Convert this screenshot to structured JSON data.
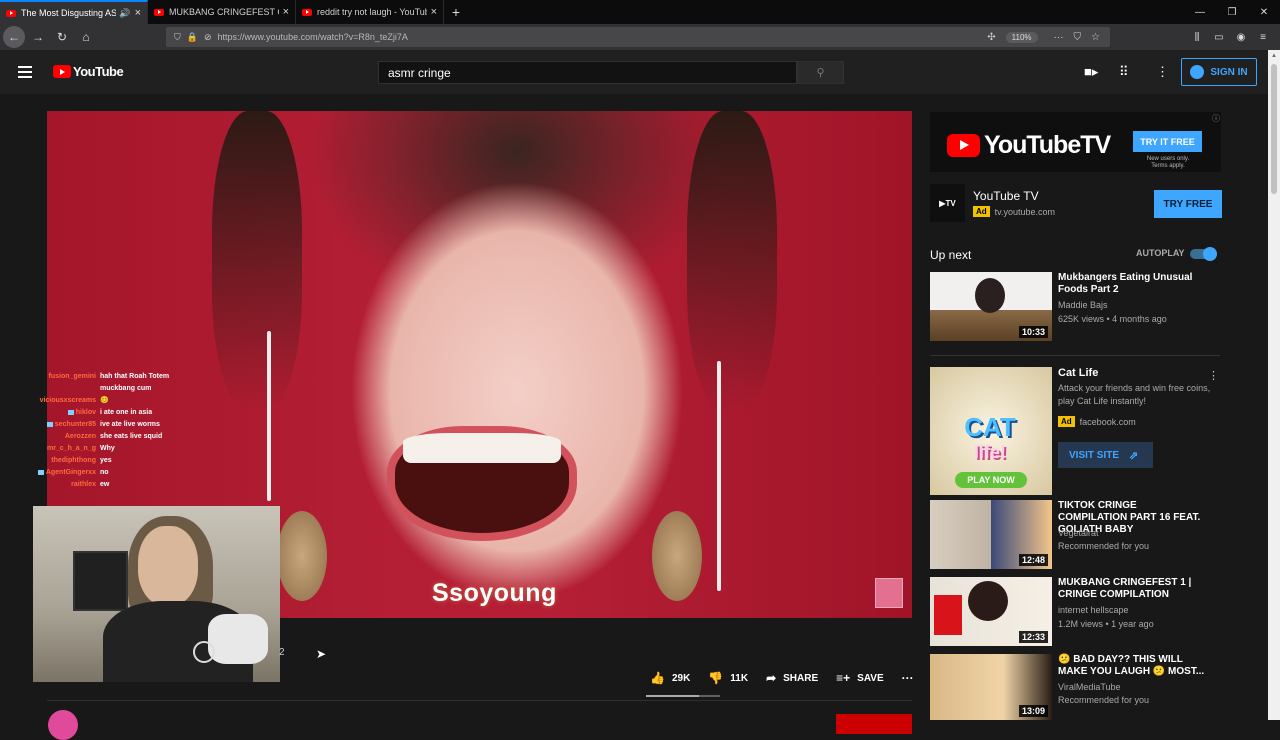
{
  "browser": {
    "tabs": [
      {
        "title": "The Most Disgusting ASMR",
        "active": true,
        "audio": true
      },
      {
        "title": "MUKBANG CRINGEFEST CRING",
        "active": false
      },
      {
        "title": "reddit try not laugh - YouTube",
        "active": false
      }
    ],
    "url": "https://www.youtube.com/watch?v=R8n_teZji7A",
    "zoom": "110%"
  },
  "header": {
    "logo_text": "YouTube",
    "search_value": "asmr cringe",
    "signin_label": "SIGN IN"
  },
  "video": {
    "subtitle": "Ssoyoung",
    "stray_char": "2"
  },
  "chat": [
    {
      "user": "fusion_gemini",
      "color": "#ff6a3d",
      "msg": "hah that Roah Totem"
    },
    {
      "user": "",
      "color": "#c02020",
      "msg": "muckbang cum"
    },
    {
      "user": "viciousxscreams",
      "color": "#ff6a3d",
      "msg": "😊"
    },
    {
      "user": "hiklov",
      "color": "#ff6a3d",
      "msg": "i ate one in asia",
      "badge": true
    },
    {
      "user": "sechunter85",
      "color": "#ff6a3d",
      "msg": "ive ate live worms",
      "badge": true
    },
    {
      "user": "Aerozzen",
      "color": "#ff6a3d",
      "msg": "she eats live squid"
    },
    {
      "user": "mr_c_h_a_n_g",
      "color": "#ff6a3d",
      "msg": "Why"
    },
    {
      "user": "thediphthong",
      "color": "#ff6a3d",
      "msg": "yes"
    },
    {
      "user": "AgentGingerxx",
      "color": "#ff6a3d",
      "msg": "no",
      "badge": true
    },
    {
      "user": "raithlex",
      "color": "#ff6a3d",
      "msg": "ew"
    }
  ],
  "actions": {
    "likes": "29K",
    "dislikes": "11K",
    "share": "SHARE",
    "save": "SAVE",
    "like_ratio": 0.72
  },
  "sidebar": {
    "banner_brand": "YouTubeTV",
    "banner_cta": "TRY IT FREE",
    "banner_note_1": "New users only.",
    "banner_note_2": "Terms apply.",
    "ad_name": "YouTube TV",
    "ad_badge": "Ad",
    "ad_domain": "tv.youtube.com",
    "ad_cta": "TRY FREE",
    "ad_logo": "TV",
    "upnext_label": "Up next",
    "autoplay_label": "AUTOPLAY",
    "autoplay_on": true,
    "videos": [
      {
        "title": "Mukbangers Eating Unusual Foods Part 2",
        "channel": "Maddie Bajs",
        "meta": "625K views • 4 months ago",
        "duration": "10:33"
      },
      {
        "title": "TIKTOK CRINGE COMPILATION PART 16 FEAT. GOLIATH BABY",
        "channel": "Vegetalrat",
        "meta": "Recommended for you",
        "duration": "12:48"
      },
      {
        "title": "MUKBANG CRINGEFEST 1 | CRINGE COMPILATION",
        "channel": "internet hellscape",
        "meta": "1.2M views • 1 year ago",
        "duration": "12:33"
      },
      {
        "title": "😕 BAD DAY?? THIS WILL MAKE YOU LAUGH 😕 MOST...",
        "channel": "ViralMediaTube",
        "meta": "Recommended for you",
        "duration": "13:09"
      }
    ],
    "cat_ad": {
      "title": "Cat Life",
      "desc": "Attack your friends and win free coins, play Cat Life instantly!",
      "badge": "Ad",
      "domain": "facebook.com",
      "cta": "VISIT SITE",
      "thumb_title": "CAT",
      "thumb_sub": "life!",
      "thumb_cta": "PLAY NOW"
    }
  }
}
